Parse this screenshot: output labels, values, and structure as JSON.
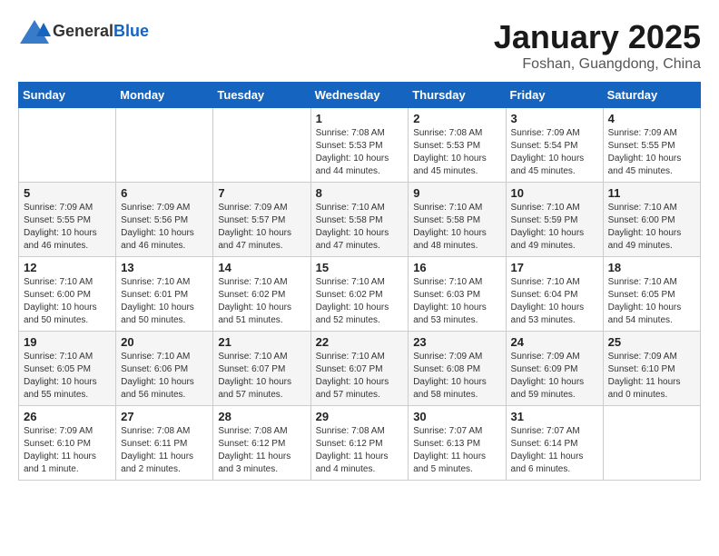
{
  "header": {
    "logo_general": "General",
    "logo_blue": "Blue",
    "month_title": "January 2025",
    "location": "Foshan, Guangdong, China"
  },
  "weekdays": [
    "Sunday",
    "Monday",
    "Tuesday",
    "Wednesday",
    "Thursday",
    "Friday",
    "Saturday"
  ],
  "weeks": [
    [
      {
        "day": "",
        "info": ""
      },
      {
        "day": "",
        "info": ""
      },
      {
        "day": "",
        "info": ""
      },
      {
        "day": "1",
        "info": "Sunrise: 7:08 AM\nSunset: 5:53 PM\nDaylight: 10 hours\nand 44 minutes."
      },
      {
        "day": "2",
        "info": "Sunrise: 7:08 AM\nSunset: 5:53 PM\nDaylight: 10 hours\nand 45 minutes."
      },
      {
        "day": "3",
        "info": "Sunrise: 7:09 AM\nSunset: 5:54 PM\nDaylight: 10 hours\nand 45 minutes."
      },
      {
        "day": "4",
        "info": "Sunrise: 7:09 AM\nSunset: 5:55 PM\nDaylight: 10 hours\nand 45 minutes."
      }
    ],
    [
      {
        "day": "5",
        "info": "Sunrise: 7:09 AM\nSunset: 5:55 PM\nDaylight: 10 hours\nand 46 minutes."
      },
      {
        "day": "6",
        "info": "Sunrise: 7:09 AM\nSunset: 5:56 PM\nDaylight: 10 hours\nand 46 minutes."
      },
      {
        "day": "7",
        "info": "Sunrise: 7:09 AM\nSunset: 5:57 PM\nDaylight: 10 hours\nand 47 minutes."
      },
      {
        "day": "8",
        "info": "Sunrise: 7:10 AM\nSunset: 5:58 PM\nDaylight: 10 hours\nand 47 minutes."
      },
      {
        "day": "9",
        "info": "Sunrise: 7:10 AM\nSunset: 5:58 PM\nDaylight: 10 hours\nand 48 minutes."
      },
      {
        "day": "10",
        "info": "Sunrise: 7:10 AM\nSunset: 5:59 PM\nDaylight: 10 hours\nand 49 minutes."
      },
      {
        "day": "11",
        "info": "Sunrise: 7:10 AM\nSunset: 6:00 PM\nDaylight: 10 hours\nand 49 minutes."
      }
    ],
    [
      {
        "day": "12",
        "info": "Sunrise: 7:10 AM\nSunset: 6:00 PM\nDaylight: 10 hours\nand 50 minutes."
      },
      {
        "day": "13",
        "info": "Sunrise: 7:10 AM\nSunset: 6:01 PM\nDaylight: 10 hours\nand 50 minutes."
      },
      {
        "day": "14",
        "info": "Sunrise: 7:10 AM\nSunset: 6:02 PM\nDaylight: 10 hours\nand 51 minutes."
      },
      {
        "day": "15",
        "info": "Sunrise: 7:10 AM\nSunset: 6:02 PM\nDaylight: 10 hours\nand 52 minutes."
      },
      {
        "day": "16",
        "info": "Sunrise: 7:10 AM\nSunset: 6:03 PM\nDaylight: 10 hours\nand 53 minutes."
      },
      {
        "day": "17",
        "info": "Sunrise: 7:10 AM\nSunset: 6:04 PM\nDaylight: 10 hours\nand 53 minutes."
      },
      {
        "day": "18",
        "info": "Sunrise: 7:10 AM\nSunset: 6:05 PM\nDaylight: 10 hours\nand 54 minutes."
      }
    ],
    [
      {
        "day": "19",
        "info": "Sunrise: 7:10 AM\nSunset: 6:05 PM\nDaylight: 10 hours\nand 55 minutes."
      },
      {
        "day": "20",
        "info": "Sunrise: 7:10 AM\nSunset: 6:06 PM\nDaylight: 10 hours\nand 56 minutes."
      },
      {
        "day": "21",
        "info": "Sunrise: 7:10 AM\nSunset: 6:07 PM\nDaylight: 10 hours\nand 57 minutes."
      },
      {
        "day": "22",
        "info": "Sunrise: 7:10 AM\nSunset: 6:07 PM\nDaylight: 10 hours\nand 57 minutes."
      },
      {
        "day": "23",
        "info": "Sunrise: 7:09 AM\nSunset: 6:08 PM\nDaylight: 10 hours\nand 58 minutes."
      },
      {
        "day": "24",
        "info": "Sunrise: 7:09 AM\nSunset: 6:09 PM\nDaylight: 10 hours\nand 59 minutes."
      },
      {
        "day": "25",
        "info": "Sunrise: 7:09 AM\nSunset: 6:10 PM\nDaylight: 11 hours\nand 0 minutes."
      }
    ],
    [
      {
        "day": "26",
        "info": "Sunrise: 7:09 AM\nSunset: 6:10 PM\nDaylight: 11 hours\nand 1 minute."
      },
      {
        "day": "27",
        "info": "Sunrise: 7:08 AM\nSunset: 6:11 PM\nDaylight: 11 hours\nand 2 minutes."
      },
      {
        "day": "28",
        "info": "Sunrise: 7:08 AM\nSunset: 6:12 PM\nDaylight: 11 hours\nand 3 minutes."
      },
      {
        "day": "29",
        "info": "Sunrise: 7:08 AM\nSunset: 6:12 PM\nDaylight: 11 hours\nand 4 minutes."
      },
      {
        "day": "30",
        "info": "Sunrise: 7:07 AM\nSunset: 6:13 PM\nDaylight: 11 hours\nand 5 minutes."
      },
      {
        "day": "31",
        "info": "Sunrise: 7:07 AM\nSunset: 6:14 PM\nDaylight: 11 hours\nand 6 minutes."
      },
      {
        "day": "",
        "info": ""
      }
    ]
  ]
}
